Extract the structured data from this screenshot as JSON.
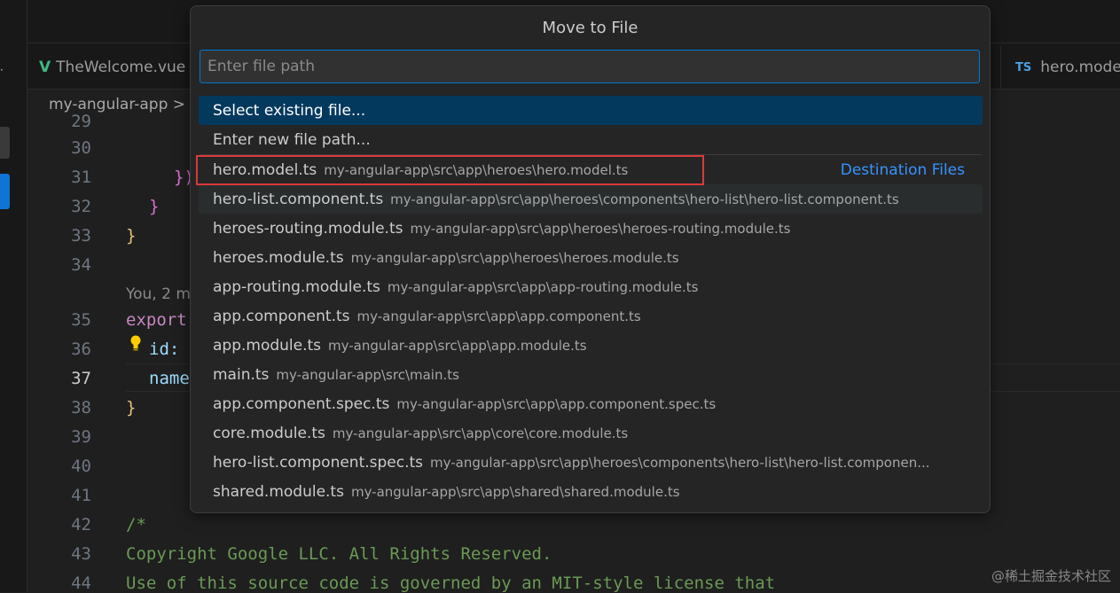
{
  "tabs": [
    {
      "label": "TheWelcome.vue",
      "icon": "vue-icon"
    },
    {
      "label": "hero.mode",
      "icon": "ts-icon",
      "icon_text": "TS"
    }
  ],
  "breadcrumb": "my-angular-app >",
  "editor": {
    "line_numbers": [
      "29",
      "30",
      "31",
      "32",
      "33",
      "34",
      "35",
      "36",
      "37",
      "38",
      "39",
      "40",
      "41",
      "42",
      "43",
      "44"
    ],
    "active_line": "37",
    "code": {
      "l31": "});",
      "l32": "}",
      "l33": "}",
      "blame": "You, 2 m",
      "l35_kw": "export",
      "l36_prop": "id:",
      "l37_prop": "name",
      "l38": "}",
      "l42": "/*",
      "l43": "Copyright Google LLC. All Rights Reserved.",
      "l44": "Use of this source code is governed by an MIT-style license that"
    }
  },
  "quick_pick": {
    "title": "Move to File",
    "input_placeholder": "Enter file path",
    "input_value": "",
    "group_label": "Destination Files",
    "items": [
      {
        "label": "Select existing file...",
        "desc": ""
      },
      {
        "label": "Enter new file path...",
        "desc": ""
      },
      {
        "label": "hero.model.ts",
        "desc": "my-angular-app\\src\\app\\heroes\\hero.model.ts"
      },
      {
        "label": "hero-list.component.ts",
        "desc": "my-angular-app\\src\\app\\heroes\\components\\hero-list\\hero-list.component.ts"
      },
      {
        "label": "heroes-routing.module.ts",
        "desc": "my-angular-app\\src\\app\\heroes\\heroes-routing.module.ts"
      },
      {
        "label": "heroes.module.ts",
        "desc": "my-angular-app\\src\\app\\heroes\\heroes.module.ts"
      },
      {
        "label": "app-routing.module.ts",
        "desc": "my-angular-app\\src\\app\\app-routing.module.ts"
      },
      {
        "label": "app.component.ts",
        "desc": "my-angular-app\\src\\app\\app.component.ts"
      },
      {
        "label": "app.module.ts",
        "desc": "my-angular-app\\src\\app\\app.module.ts"
      },
      {
        "label": "main.ts",
        "desc": "my-angular-app\\src\\main.ts"
      },
      {
        "label": "app.component.spec.ts",
        "desc": "my-angular-app\\src\\app\\app.component.spec.ts"
      },
      {
        "label": "core.module.ts",
        "desc": "my-angular-app\\src\\app\\core\\core.module.ts"
      },
      {
        "label": "hero-list.component.spec.ts",
        "desc": "my-angular-app\\src\\app\\heroes\\components\\hero-list\\hero-list.componen..."
      },
      {
        "label": "shared.module.ts",
        "desc": "my-angular-app\\src\\app\\shared\\shared.module.ts"
      }
    ]
  },
  "watermark": "@稀土掘金技术社区",
  "colors": {
    "accent": "#0078d4",
    "selection": "#04395e",
    "highlight": "#d93a3a",
    "group_label": "#3794ff"
  }
}
